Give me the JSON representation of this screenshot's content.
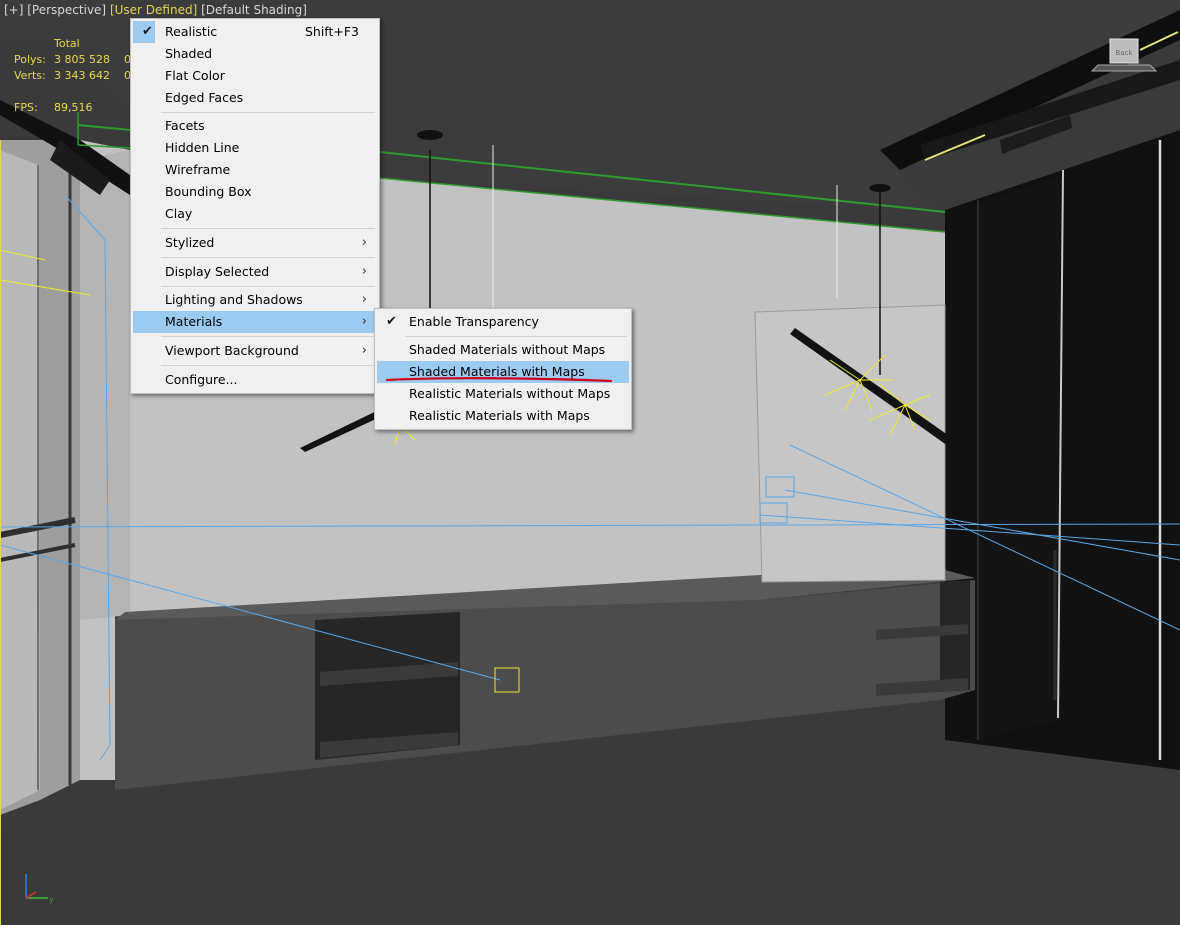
{
  "viewport": {
    "label_plus": "[+]",
    "label_view": "[Perspective]",
    "label_mode": "[User Defined]",
    "label_shading": "[Default Shading]"
  },
  "stats": {
    "header": "Total",
    "polys_label": "Polys:",
    "polys_value": "3 805 528",
    "polys_extra": "0",
    "verts_label": "Verts:",
    "verts_value": "3 343 642",
    "verts_extra": "0",
    "fps_label": "FPS:",
    "fps_value": "89,516"
  },
  "main_menu": {
    "items": [
      {
        "label": "Realistic",
        "shortcut": "Shift+F3",
        "checked": true
      },
      {
        "label": "Shaded"
      },
      {
        "label": "Flat Color"
      },
      {
        "label": "Edged Faces"
      },
      {
        "label": "Facets"
      },
      {
        "label": "Hidden Line"
      },
      {
        "label": "Wireframe"
      },
      {
        "label": "Bounding Box"
      },
      {
        "label": "Clay"
      },
      {
        "label": "Stylized",
        "submenu": true
      },
      {
        "label": "Display Selected",
        "submenu": true
      },
      {
        "label": "Lighting and Shadows",
        "submenu": true
      },
      {
        "label": "Materials",
        "submenu": true,
        "highlighted": true
      },
      {
        "label": "Viewport Background",
        "submenu": true
      },
      {
        "label": "Configure..."
      }
    ]
  },
  "materials_submenu": {
    "items": [
      {
        "label": "Enable Transparency",
        "checked": true
      },
      {
        "label": "Shaded Materials without Maps"
      },
      {
        "label": "Shaded Materials with Maps",
        "highlighted": true
      },
      {
        "label": "Realistic Materials without Maps"
      },
      {
        "label": "Realistic Materials with Maps"
      }
    ]
  },
  "colors": {
    "menu_bg": "#f0f0f0",
    "highlight": "#9ccbf2",
    "annotation": "#d0021b",
    "stats_text": "#e5d74e",
    "trim_green": "#2f9a2f"
  },
  "icons": {
    "check": "check-icon",
    "submenu": "chevron-right-icon",
    "nav_cube": "viewcube-icon",
    "axis": "axis-tripod-icon"
  }
}
